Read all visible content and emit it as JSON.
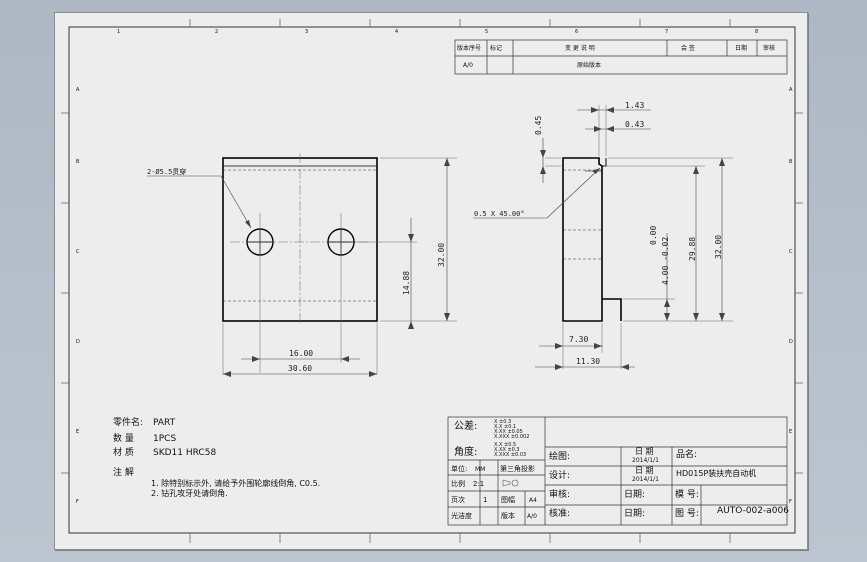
{
  "revision_table": {
    "headers": [
      "版本序号",
      "标记",
      "变 更 说 明",
      "会 签",
      "日期",
      "审核"
    ],
    "row_version": "A/0",
    "row_note": "原始版本"
  },
  "border_numbers_top": [
    "1",
    "2",
    "3",
    "4",
    "5",
    "6",
    "7",
    "8"
  ],
  "border_letters_side": [
    "A",
    "B",
    "C",
    "D",
    "E",
    "F"
  ],
  "front_view": {
    "hole_callout": "2-Ø5.5贯穿",
    "dim_height": "32.00",
    "dim_hole_height": "14.88",
    "dim_hole_spacing": "16.00",
    "dim_width": "30.60"
  },
  "side_view": {
    "dim_top_width": "1.43",
    "dim_step": "0.43",
    "dim_chamfer_height": "0.45",
    "chamfer_note": "0.5 X 45.00°",
    "dim_zero": "0.00",
    "dim_tol": "4.00 -0.02",
    "dim_inner_height": "29.88",
    "dim_height": "32.00",
    "dim_lower_width": "7.30",
    "dim_total_width": "11.30"
  },
  "part_info": {
    "name_label": "零件名:",
    "name_value": "PART",
    "qty_label": "数 量",
    "qty_value": "1PCS",
    "material_label": "材 质",
    "material_value": "SKD11 HRC58",
    "notes_title": "注 解",
    "note1": "1. 除特别标示外, 请给予外围轮廓线倒角, C0.5.",
    "note2": "2. 钻孔攻牙处请倒角."
  },
  "title_block": {
    "tolerance_label": "公差:",
    "tolerance_values": [
      "X ±0.3",
      "X.X ±0.1",
      "X.XX ±0.05",
      "X.XXX ±0.002"
    ],
    "angle_label": "角度:",
    "angle_values": [
      "X.X ±0.5",
      "X.XX ±0.3",
      "X.XXX ±0.03"
    ],
    "unit_label": "单位:",
    "unit_value": "MM",
    "projection": "第三角投影",
    "scale_label": "比例",
    "scale_value": "2:1",
    "page_label": "页次",
    "page_value": "1",
    "size_label": "图幅",
    "size_value": "A4",
    "finish_label": "光洁度",
    "version_label": "版本",
    "version_value": "A/0",
    "draw_label": "绘图:",
    "design_label": "设计:",
    "review_label": "审核:",
    "check_label": "核准:",
    "date_label": "日 期",
    "date_value": "2014/1/1",
    "date_label2": "日 期",
    "date_value2": "2014/1/1",
    "date_short1": "日期:",
    "date_short2": "日期:",
    "product_label": "品名:",
    "product_value": "HD015P装扶壳自动机",
    "model_label": "模 号:",
    "drawing_no_label": "图 号:",
    "drawing_no_value": "AUTO-002-a006"
  }
}
